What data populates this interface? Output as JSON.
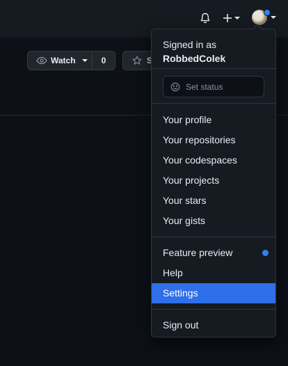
{
  "header": {
    "icons": [
      "bell-icon",
      "plus-icon",
      "avatar"
    ]
  },
  "repo_actions": {
    "watch_label": "Watch",
    "watch_count": "0",
    "star_label": "Star"
  },
  "user_menu": {
    "signed_in_as": "Signed in as",
    "username": "RobbedColek",
    "set_status_label": "Set status",
    "items_group1": [
      "Your profile",
      "Your repositories",
      "Your codespaces",
      "Your projects",
      "Your stars",
      "Your gists"
    ],
    "items_group2": [
      "Feature preview",
      "Help",
      "Settings"
    ],
    "sign_out": "Sign out",
    "active_item": "Settings"
  },
  "colors": {
    "background": "#0d1117",
    "header": "#161b22",
    "accent": "#2f81f7",
    "active_item": "#2f6fe8"
  }
}
